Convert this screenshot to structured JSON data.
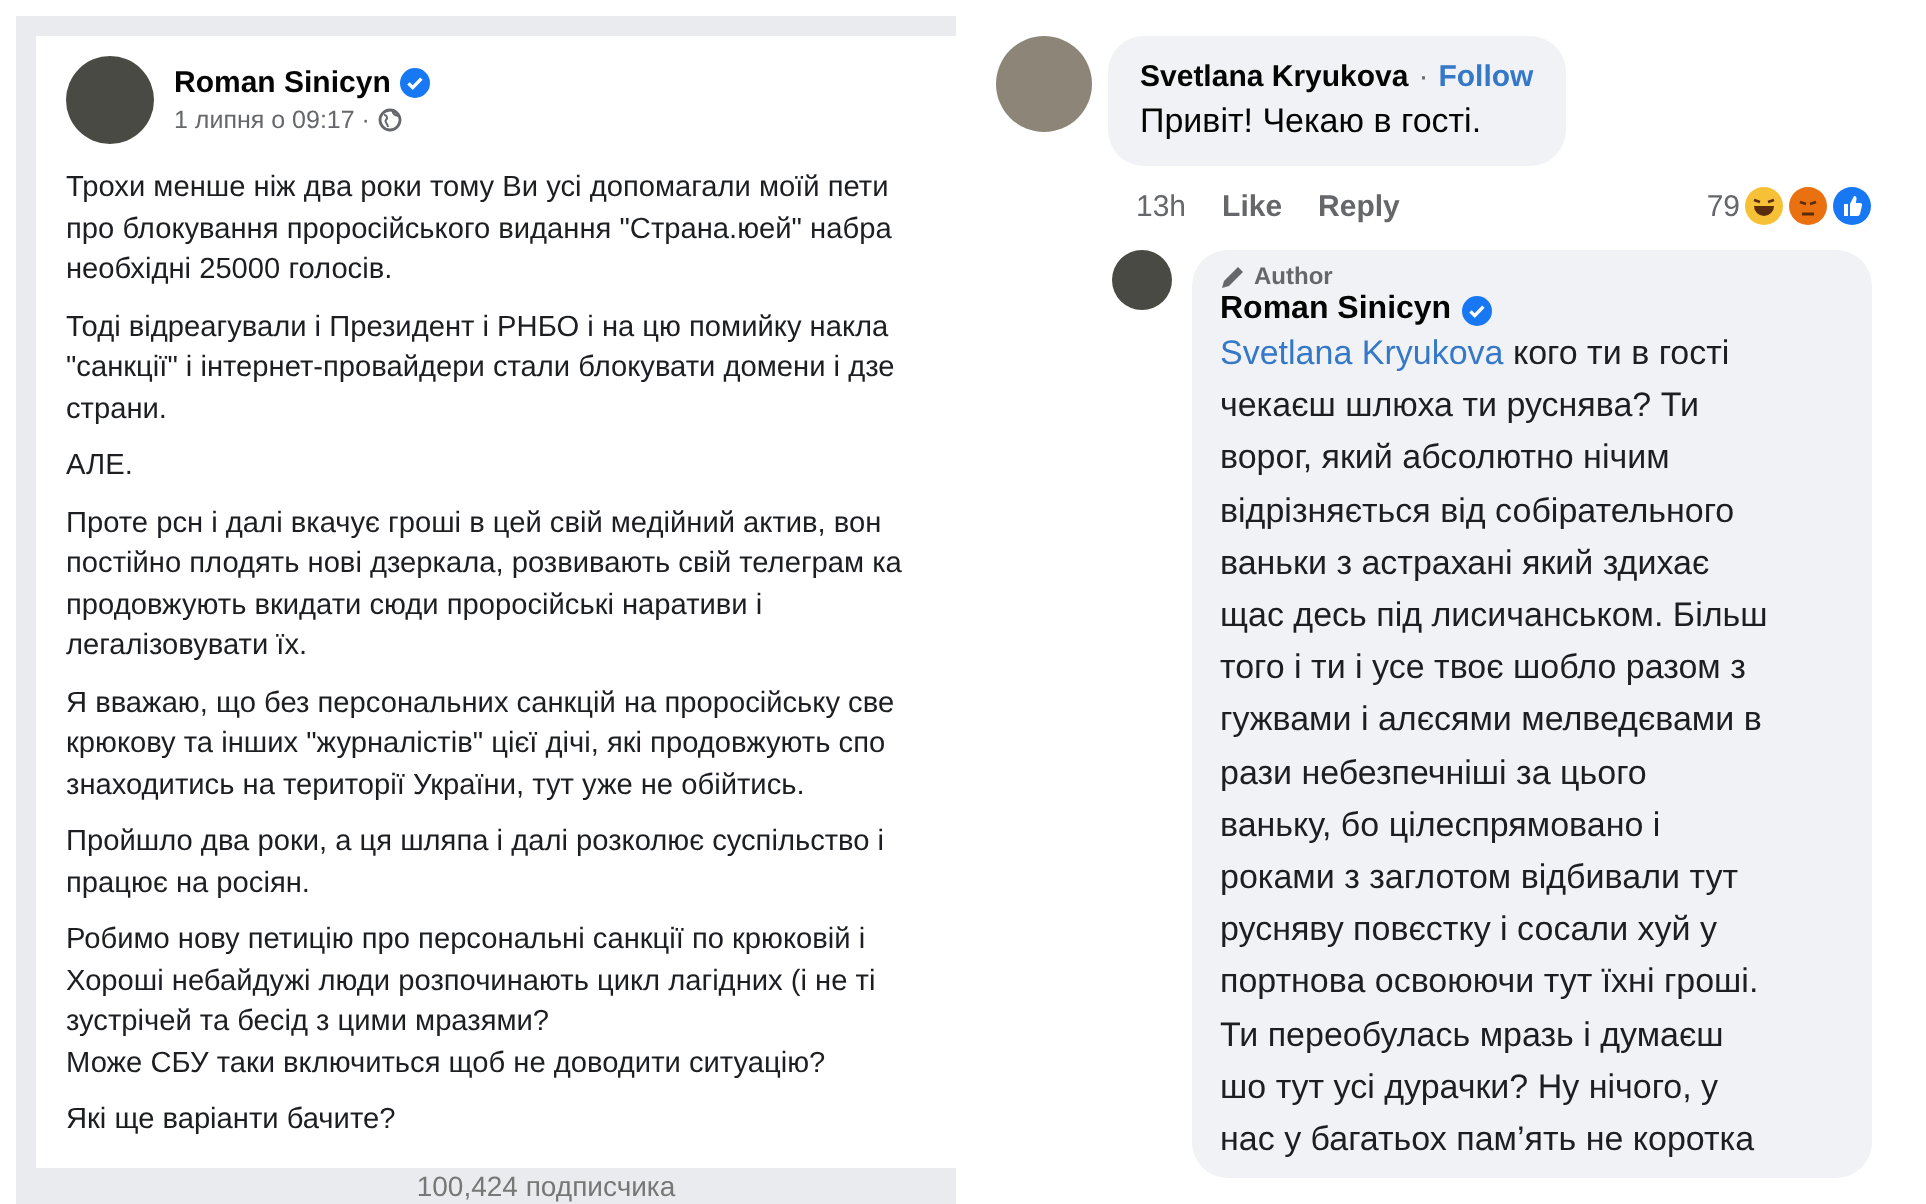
{
  "post": {
    "author": "Roman Sinicyn",
    "date": "1 липня о 09:17 ·",
    "paragraphs": [
      [
        "Трохи менше ніж два роки тому Ви усі допомагали моїй пети",
        "про блокування проросійського видання \"Страна.юей\" набра",
        "необхідні 25000 голосів."
      ],
      [
        "Тоді відреагували і Президент і РНБО і на цю помийку накла",
        "\"санкції\" і інтернет-провайдери стали блокувати домени і дзе",
        "страни."
      ],
      [
        "АЛЕ."
      ],
      [
        "Проте рсн і далі вкачує гроші в цей свій медійний актив, вон",
        "постійно плодять нові дзеркала, розвивають свій телеграм ка",
        "продовжують вкидати сюди проросійські наративи і",
        "легалізовувати їх."
      ],
      [
        "Я вважаю, що без персональних санкцій на проросійську све",
        "крюкову та інших \"журналістів\" цієї дічі, які продовжують спо",
        "знаходитись на території України, тут уже не обійтись."
      ],
      [
        "Пройшло два роки, а ця шляпа і далі розколює суспільство і",
        "працює на росіян."
      ],
      [
        "Робимо нову петицію про персональні санкції по крюковій і",
        "Хороші небайдужі люди розпочинають цикл лагідних (і не ті",
        "зустрічей та бесід з цими мразями?",
        "Може СБУ таки включиться щоб не доводити ситуацію?"
      ],
      [
        "Які ще варіанти бачите?"
      ]
    ],
    "followers": "100,424 подписчика"
  },
  "comment": {
    "author": "Svetlana Kryukova",
    "separator": "·",
    "follow": "Follow",
    "text": "Привіт! Чекаю в гості.",
    "time": "13h",
    "like": "Like",
    "reply": "Reply",
    "reaction_count": "79"
  },
  "reply": {
    "badge": "Author",
    "author": "Roman Sinicyn",
    "mention": "Svetlana Kryukova",
    "lines": [
      " кого ти в гості",
      "чекаєш шлюха ти руснява? Ти",
      "ворог, який абсолютно нічим",
      "відрізняється від собірательного",
      "ваньки з астрахані який здихає",
      "щас десь під лисичанськом. Більш",
      "того і ти і усе твоє шобло разом з",
      "гужвами і алєсями мелведєвами в",
      "рази небезпечніші за цього",
      "ваньку, бо цілеспрямовано і",
      "роками з заглотом відбивали тут",
      "русняву повєстку і сосали хуй у",
      "портнова освоюючи тут їхні гроші.",
      "Ти переобулась мразь і думаєш",
      "шо тут усі дурачки? Ну нічого, у",
      "нас у багатьох пам’ять не коротка"
    ]
  }
}
